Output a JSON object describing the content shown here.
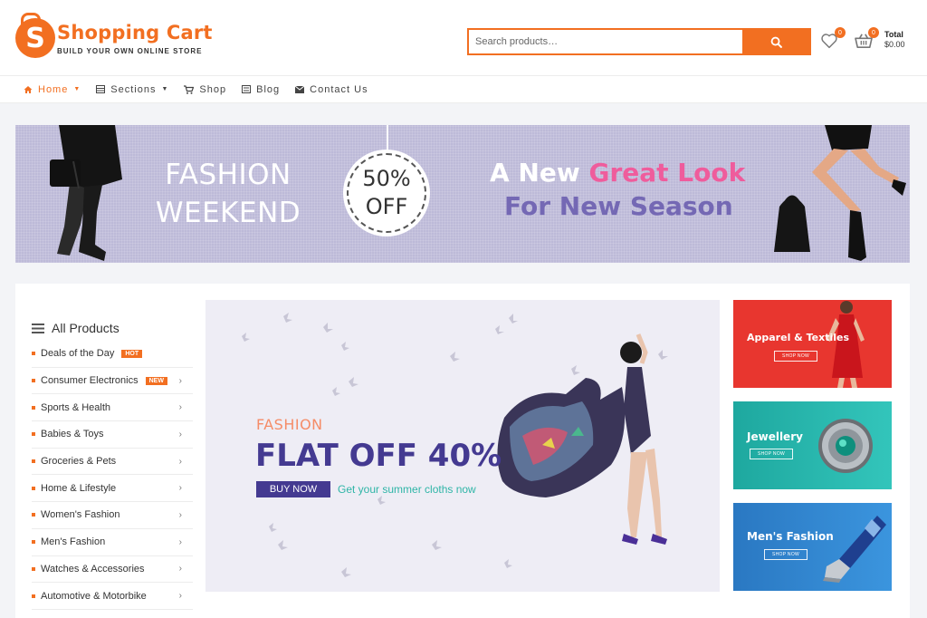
{
  "header": {
    "logo_letter": "S",
    "logo_title": "Shopping Cart",
    "logo_tagline": "BUILD YOUR OWN ONLINE STORE",
    "search_placeholder": "Search products…",
    "wishlist_count": "0",
    "cart_count": "0",
    "total_label": "Total",
    "total_value": "$0.00"
  },
  "nav": {
    "items": [
      {
        "label": "Home",
        "icon": "home-icon"
      },
      {
        "label": "Sections",
        "icon": "grid-icon"
      },
      {
        "label": "Shop",
        "icon": "cart-icon"
      },
      {
        "label": "Blog",
        "icon": "list-icon"
      },
      {
        "label": "Contact Us",
        "icon": "envelope-icon"
      }
    ]
  },
  "banner": {
    "left_line1": "FASHION",
    "left_line2": "WEEKEND",
    "tag_line1": "50%",
    "tag_line2": "OFF",
    "right_a": "A New ",
    "right_b": "Great Look",
    "right_line2": "For New Season"
  },
  "sidebar": {
    "heading": "All Products",
    "items": [
      {
        "label": "Deals of the Day",
        "tag": "HOT"
      },
      {
        "label": "Consumer Electronics",
        "tag": "NEW"
      },
      {
        "label": "Sports & Health"
      },
      {
        "label": "Babies & Toys"
      },
      {
        "label": "Groceries & Pets"
      },
      {
        "label": "Home & Lifestyle"
      },
      {
        "label": "Women's Fashion"
      },
      {
        "label": "Men's Fashion"
      },
      {
        "label": "Watches & Accessories"
      },
      {
        "label": "Automotive & Motorbike"
      }
    ]
  },
  "hero": {
    "kicker": "FASHION",
    "title": "FLAT OFF 40%",
    "button": "BUY NOW",
    "subtitle": "Get your summer cloths now"
  },
  "promos": [
    {
      "title": "Apparel & Textiles",
      "button": "SHOP NOW",
      "color": "#e8362f"
    },
    {
      "title": "Jewellery",
      "button": "SHOP NOW",
      "color": "#1ea89f"
    },
    {
      "title": "Men's Fashion",
      "button": "SHOP NOW",
      "color": "#2c7fc8"
    }
  ],
  "colors": {
    "accent": "#f26f21",
    "hero_title": "#443a91",
    "hero_sub": "#2fb5a7"
  }
}
